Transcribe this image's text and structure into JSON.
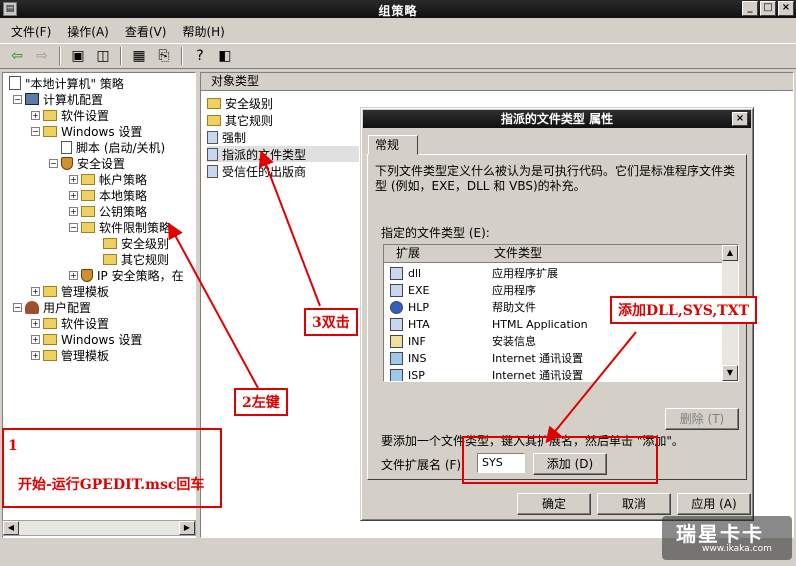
{
  "window": {
    "title": "组策略",
    "icon": "gpedit-app-icon",
    "minimize": "_",
    "maximize": "□",
    "close": "×"
  },
  "menu": [
    "文件(F)",
    "操作(A)",
    "查看(V)",
    "帮助(H)"
  ],
  "tree": [
    {
      "label": "\"本地计算机\" 策略",
      "icon": "policy-icon"
    },
    {
      "label": "计算机配置",
      "icon": "computer-icon"
    },
    {
      "label": "软件设置",
      "icon": "folder-icon"
    },
    {
      "label": "Windows 设置",
      "icon": "folder-icon"
    },
    {
      "label": "脚本 (启动/关机)",
      "icon": "doc-icon"
    },
    {
      "label": "安全设置",
      "icon": "shield-icon"
    },
    {
      "label": "帐户策略",
      "icon": "folder-icon"
    },
    {
      "label": "本地策略",
      "icon": "folder-icon"
    },
    {
      "label": "公钥策略",
      "icon": "folder-icon"
    },
    {
      "label": "软件限制策略",
      "icon": "folder-icon"
    },
    {
      "label": "安全级别",
      "icon": "folder-icon"
    },
    {
      "label": "其它规则",
      "icon": "folder-icon"
    },
    {
      "label": "IP 安全策略，在",
      "icon": "shield-icon"
    },
    {
      "label": "管理模板",
      "icon": "folder-icon"
    },
    {
      "label": "用户配置",
      "icon": "user-icon"
    },
    {
      "label": "软件设置",
      "icon": "folder-icon"
    },
    {
      "label": "Windows 设置",
      "icon": "folder-icon"
    },
    {
      "label": "管理模板",
      "icon": "folder-icon"
    }
  ],
  "right_pane": {
    "header": "对象类型",
    "items": [
      "安全级别",
      "其它规则",
      "强制",
      "指派的文件类型",
      "受信任的出版商"
    ]
  },
  "dialog": {
    "title": "指派的文件类型 属性",
    "close": "×",
    "tab": "常规",
    "description": "下列文件类型定义什么被认为是可执行代码。它们是标准程序文件类型 (例如，EXE，DLL 和 VBS)的补充。",
    "list_label": "指定的文件类型 (E):",
    "columns": [
      "扩展",
      "文件类型"
    ],
    "rows": [
      {
        "ext": "dll",
        "type": "应用程序扩展"
      },
      {
        "ext": "EXE",
        "type": "应用程序"
      },
      {
        "ext": "HLP",
        "type": "帮助文件"
      },
      {
        "ext": "HTA",
        "type": "HTML Application"
      },
      {
        "ext": "INF",
        "type": "安装信息"
      },
      {
        "ext": "INS",
        "type": "Internet 通讯设置"
      },
      {
        "ext": "ISP",
        "type": "Internet 通讯设置"
      }
    ],
    "delete_button": "删除 (T)",
    "add_hint": "要添加一个文件类型，键入其扩展名，然后单击 \"添加\"。",
    "ext_label": "文件扩展名 (F):",
    "ext_value": "SYS",
    "add_button": "添加 (D)",
    "ok_button": "确定",
    "cancel_button": "取消",
    "apply_button": "应用 (A)"
  },
  "annotations": {
    "step1_number": "1",
    "step1_text": "开始-运行GPEDIT.msc回车",
    "step2": "2左键",
    "step3": "3双击",
    "step4": "添加DLL,SYS,TXT",
    "color": "#e00000"
  },
  "watermark": {
    "text": "瑞星卡卡",
    "url": "www.ikaka.com"
  }
}
